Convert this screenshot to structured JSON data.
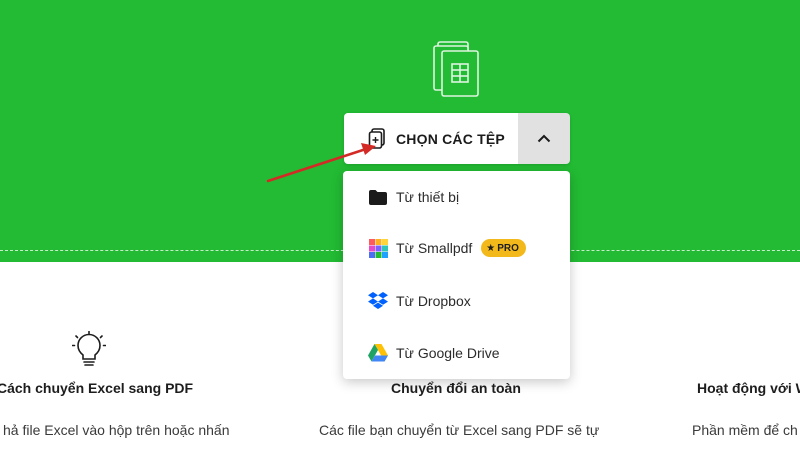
{
  "upload": {
    "choose_files_label": "CHỌN CÁC TỆP"
  },
  "dropdown": {
    "items": [
      {
        "label": "Từ thiết bị",
        "icon": "folder-icon"
      },
      {
        "label": "Từ Smallpdf",
        "icon": "smallpdf-icon",
        "badge": "PRO"
      },
      {
        "label": "Từ Dropbox",
        "icon": "dropbox-icon"
      },
      {
        "label": "Từ Google Drive",
        "icon": "google-drive-icon"
      }
    ]
  },
  "features": [
    {
      "title": "Cách chuyển Excel sang PDF",
      "text": "hả file Excel vào hộp trên hoặc nhấn"
    },
    {
      "title": "Chuyển đổi an toàn",
      "text": "Các file bạn chuyển từ Excel sang PDF sẽ tự"
    },
    {
      "title": "Hoạt động với W",
      "text": "Phần mềm để ch"
    }
  ],
  "colors": {
    "hero_background": "#22bb33",
    "pro_badge": "#f3b91b",
    "annotation_arrow": "#d42a26"
  }
}
